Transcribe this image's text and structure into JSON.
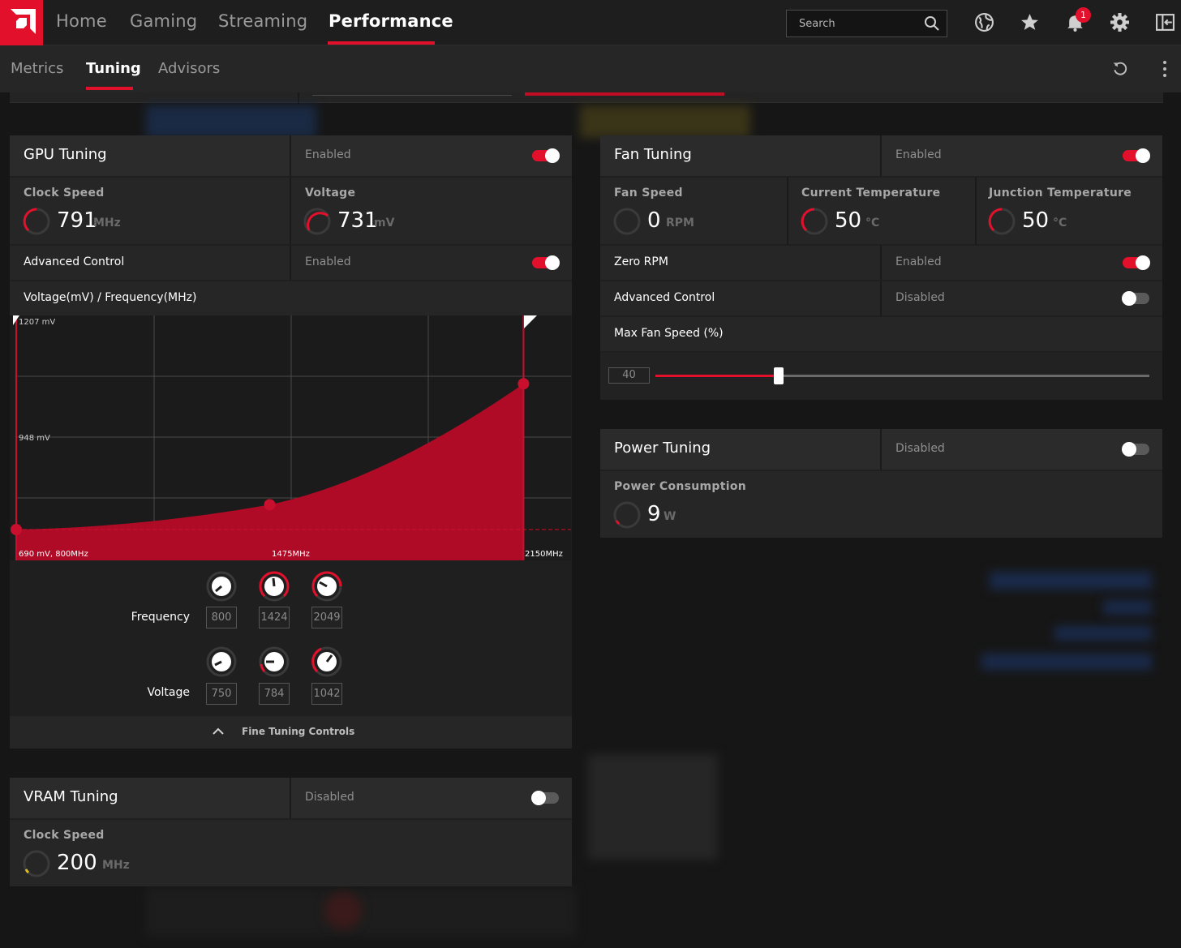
{
  "nav": {
    "tabs": [
      {
        "label": "Home"
      },
      {
        "label": "Gaming"
      },
      {
        "label": "Streaming"
      },
      {
        "label": "Performance"
      }
    ],
    "search_placeholder": "Search",
    "notification_count": "1"
  },
  "subnav": {
    "tabs": [
      {
        "label": "Metrics"
      },
      {
        "label": "Tuning"
      },
      {
        "label": "Advisors"
      }
    ]
  },
  "gpu_tuning": {
    "title": "GPU Tuning",
    "status": "Enabled",
    "enabled": true,
    "clock_speed": {
      "label": "Clock Speed",
      "value": "791",
      "unit": "MHz"
    },
    "voltage": {
      "label": "Voltage",
      "value": "731",
      "unit": "mV"
    },
    "advanced_control": {
      "label": "Advanced Control",
      "status": "Enabled",
      "enabled": true
    },
    "curve_title": "Voltage(mV) / Frequency(MHz)",
    "chart_labels": {
      "top_left": "1207 mV",
      "mid_left": "948 mV",
      "bottom_left": "690 mV, 800MHz",
      "bottom_mid": "1475MHz",
      "bottom_right": "2150MHz"
    },
    "frequency_label": "Frequency",
    "voltage_label": "Voltage",
    "frequency_values": [
      "800",
      "1424",
      "2049"
    ],
    "voltage_values": [
      "750",
      "784",
      "1042"
    ],
    "fine_tuning_label": "Fine Tuning Controls"
  },
  "chart_data": {
    "type": "area",
    "title": "Voltage(mV) / Frequency(MHz)",
    "xlabel": "Frequency (MHz)",
    "ylabel": "Voltage (mV)",
    "xlim": [
      800,
      2150
    ],
    "ylim": [
      690,
      1207
    ],
    "points": [
      {
        "x": 800,
        "y": 690
      },
      {
        "x": 1424,
        "y": 750
      },
      {
        "x": 2049,
        "y": 1042
      }
    ],
    "color": "#c8102e"
  },
  "fan_tuning": {
    "title": "Fan Tuning",
    "status": "Enabled",
    "enabled": true,
    "fan_speed": {
      "label": "Fan Speed",
      "value": "0",
      "unit": "RPM"
    },
    "current_temp": {
      "label": "Current Temperature",
      "value": "50",
      "unit": "°C"
    },
    "junction_temp": {
      "label": "Junction Temperature",
      "value": "50",
      "unit": "°C"
    },
    "zero_rpm": {
      "label": "Zero RPM",
      "status": "Enabled",
      "enabled": true
    },
    "advanced_control": {
      "label": "Advanced Control",
      "status": "Disabled",
      "enabled": false
    },
    "max_fan_speed": {
      "label": "Max Fan Speed (%)",
      "value": "40",
      "fraction": 0.25
    }
  },
  "power_tuning": {
    "title": "Power Tuning",
    "status": "Disabled",
    "enabled": false,
    "power_consumption": {
      "label": "Power Consumption",
      "value": "9",
      "unit": "W"
    }
  },
  "vram_tuning": {
    "title": "VRAM Tuning",
    "status": "Disabled",
    "enabled": false,
    "clock_speed": {
      "label": "Clock Speed",
      "value": "200",
      "unit": "MHz"
    }
  },
  "colors": {
    "accent": "#e3102c",
    "panel": "#262626",
    "background": "#161616",
    "vram_gauge": "#e0c020"
  }
}
